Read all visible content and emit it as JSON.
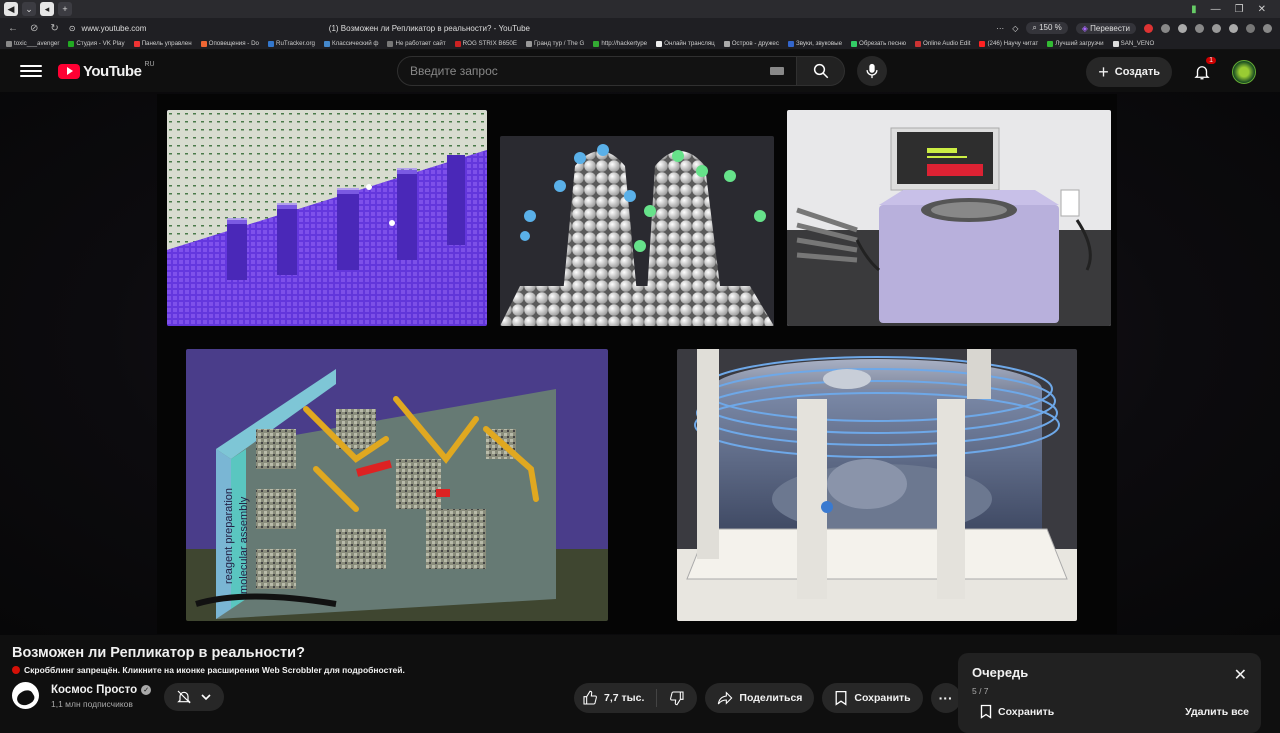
{
  "browser": {
    "url": "www.youtube.com",
    "tab_title": "(1) Возможен ли Репликатор в реальности? - YouTube",
    "zoom": "150 %",
    "translate_label": "Перевести"
  },
  "bookmarks": [
    {
      "label": "toxic___avenger",
      "color": "#888"
    },
    {
      "label": "Студия - VK Play",
      "color": "#2a2"
    },
    {
      "label": "Панель управлен",
      "color": "#e33"
    },
    {
      "label": "Оповещения - Do",
      "color": "#e63"
    },
    {
      "label": "RuTracker.org",
      "color": "#37c"
    },
    {
      "label": "Классический ф",
      "color": "#48c"
    },
    {
      "label": "Не работает сайт",
      "color": "#777"
    },
    {
      "label": "ROG STRIX B650E",
      "color": "#c22"
    },
    {
      "label": "Гранд тур / The G",
      "color": "#999"
    },
    {
      "label": "http://hackertype",
      "color": "#3a3"
    },
    {
      "label": "Онлайн трансляц",
      "color": "#eee"
    },
    {
      "label": "Остров - дружес",
      "color": "#aaa"
    },
    {
      "label": "Звуки, звуковые",
      "color": "#36c"
    },
    {
      "label": "Обрезать песню",
      "color": "#3c6"
    },
    {
      "label": "Online Audio Edit",
      "color": "#c33"
    },
    {
      "label": "(246) Научу читат",
      "color": "#f22"
    },
    {
      "label": "Лучший загрузчи",
      "color": "#3b3"
    },
    {
      "label": "SAN_VENO",
      "color": "#ddd"
    }
  ],
  "youtube": {
    "logo_text": "YouTube",
    "country_code": "RU",
    "search_placeholder": "Введите запрос",
    "create_label": "Создать",
    "notification_count": "1"
  },
  "video": {
    "title": "Возможен ли Репликатор в реальности?",
    "scrobbler_notice": "Скробблинг запрещён. Кликните на иконке расширения Web Scrobbler для подробностей.",
    "channel_name": "Космос Просто",
    "subscribers": "1,1 млн подписчиков",
    "likes": "7,7 тыс.",
    "share_label": "Поделиться",
    "save_label": "Сохранить",
    "diagram_labels": {
      "reagent": "reagent preparation",
      "assembly": "molecular assembly"
    }
  },
  "queue": {
    "title": "Очередь",
    "count": "5 / 7",
    "save_label": "Сохранить",
    "delete_all_label": "Удалить все"
  },
  "colors": {
    "youtube_red": "#ff0033",
    "background": "#0f0f0f",
    "button_bg": "#272727"
  }
}
